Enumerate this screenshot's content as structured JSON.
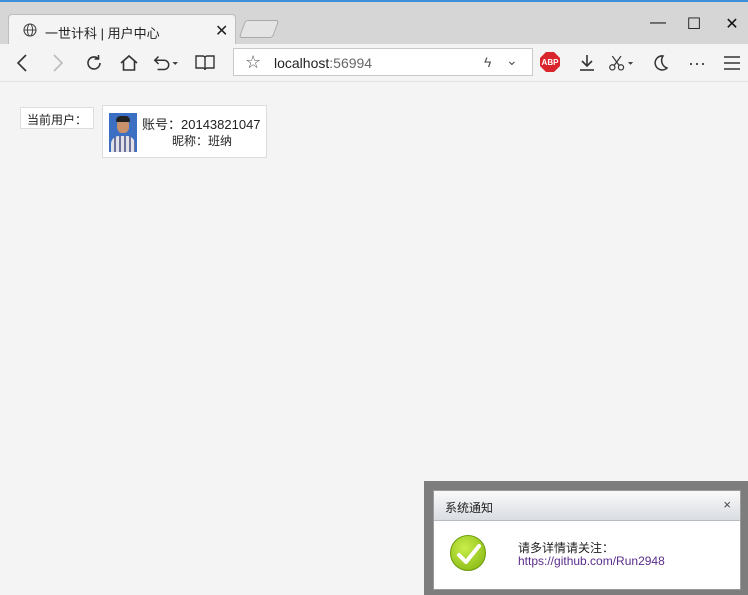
{
  "browser": {
    "tab": {
      "title": "一世计科 | 用户中心",
      "close_glyph": "✕"
    },
    "window_controls": {
      "minimize": "—",
      "maximize": "☐",
      "close": "✕"
    },
    "address": {
      "host": "localhost",
      "port": ":56994"
    },
    "toolbar_icons": [
      "back-icon",
      "forward-icon",
      "refresh-icon",
      "home-icon",
      "undo-icon",
      "reading-view-icon",
      "favorite-star-icon",
      "abp-icon",
      "download-icon",
      "scissors-icon",
      "moon-icon",
      "more-icon",
      "menu-icon"
    ],
    "abp_label": "ABP",
    "more_glyph": "···"
  },
  "page": {
    "current_user_label": "当前用户：",
    "user": {
      "account": "账号：20143821047",
      "nickname": "昵称：班纳"
    }
  },
  "notification": {
    "title": "系统通知",
    "close_glyph": "×",
    "message": "请多详情请关注：",
    "link": "https://github.com/Run2948"
  }
}
